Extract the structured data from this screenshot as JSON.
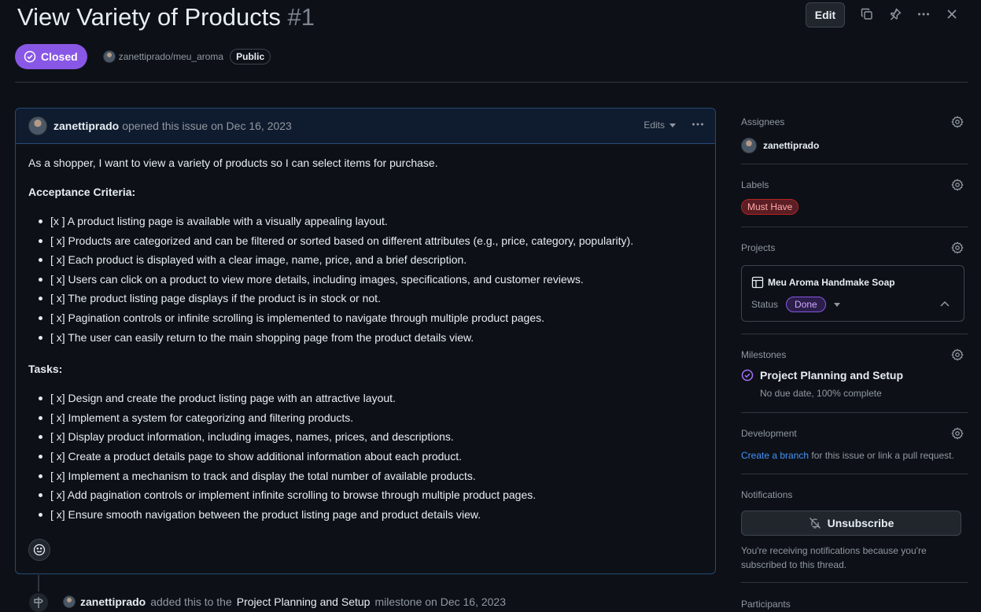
{
  "issue": {
    "title": "View Variety of Products",
    "number": "#1",
    "edit_label": "Edit",
    "state": "Closed",
    "repo": "zanettiprado/meu_aroma",
    "visibility": "Public"
  },
  "comment": {
    "author": "zanettiprado",
    "action": "opened this issue on Dec 16, 2023",
    "edits_label": "Edits",
    "intro": "As a shopper, I want to view a variety of products so I can select items for purchase.",
    "criteria_heading": "Acceptance Criteria:",
    "criteria": [
      "[x ] A product listing page is available with a visually appealing layout.",
      "[ x] Products are categorized and can be filtered or sorted based on different attributes (e.g., price, category, popularity).",
      "[ x] Each product is displayed with a clear image, name, price, and a brief description.",
      "[ x] Users can click on a product to view more details, including images, specifications, and customer reviews.",
      "[ x] The product listing page displays if the product is in stock or not.",
      "[ x] Pagination controls or infinite scrolling is implemented to navigate through multiple product pages.",
      "[ x] The user can easily return to the main shopping page from the product details view."
    ],
    "tasks_heading": "Tasks:",
    "tasks": [
      "[ x] Design and create the product listing page with an attractive layout.",
      "[ x] Implement a system for categorizing and filtering products.",
      "[ x] Display product information, including images, names, prices, and descriptions.",
      "[ x] Create a product details page to show additional information about each product.",
      "[ x] Implement a mechanism to track and display the total number of available products.",
      "[ x] Add pagination controls or implement infinite scrolling to browse through multiple product pages.",
      "[ x] Ensure smooth navigation between the product listing page and product details view."
    ]
  },
  "timeline": {
    "author": "zanettiprado",
    "text1": "added this to the",
    "milestone": "Project Planning and Setup",
    "text2": "milestone on Dec 16, 2023"
  },
  "sidebar": {
    "assignees_title": "Assignees",
    "assignee": "zanettiprado",
    "labels_title": "Labels",
    "label": "Must Have",
    "projects_title": "Projects",
    "project_name": "Meu Aroma Handmake Soap",
    "status_label": "Status",
    "status_value": "Done",
    "milestones_title": "Milestones",
    "milestone_name": "Project Planning and Setup",
    "milestone_sub": "No due date, 100% complete",
    "development_title": "Development",
    "dev_link": "Create a branch",
    "dev_text": " for this issue or link a pull request.",
    "notifications_title": "Notifications",
    "unsubscribe_label": "Unsubscribe",
    "notif_text": "You're receiving notifications because you're subscribed to this thread.",
    "participants_title": "Participants"
  },
  "colors": {
    "closed": "#8957e5",
    "bg": "#0d1117",
    "link": "#4493f8",
    "label_red": "#b62324"
  }
}
